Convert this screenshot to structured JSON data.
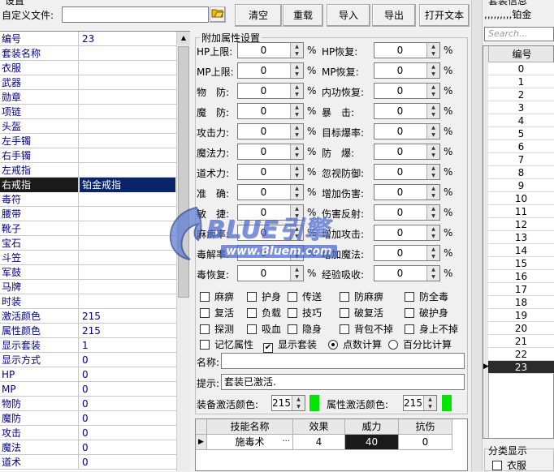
{
  "header": {
    "title_top": "设置",
    "custom_file_label": "自定义文件:",
    "custom_file_value": "",
    "buttons": [
      "清空",
      "重载",
      "导入",
      "导出",
      "打开文本"
    ]
  },
  "left_list": {
    "rows": [
      {
        "k": "编号",
        "v": "23"
      },
      {
        "k": "套装名称",
        "v": ""
      },
      {
        "k": "衣服",
        "v": ""
      },
      {
        "k": "武器",
        "v": ""
      },
      {
        "k": "勋章",
        "v": ""
      },
      {
        "k": "项链",
        "v": ""
      },
      {
        "k": "头盔",
        "v": ""
      },
      {
        "k": "左手镯",
        "v": ""
      },
      {
        "k": "右手镯",
        "v": ""
      },
      {
        "k": "左戒指",
        "v": ""
      },
      {
        "k": "右戒指",
        "v": "铂金戒指"
      },
      {
        "k": "毒符",
        "v": ""
      },
      {
        "k": "腰带",
        "v": ""
      },
      {
        "k": "靴子",
        "v": ""
      },
      {
        "k": "宝石",
        "v": ""
      },
      {
        "k": "斗笠",
        "v": ""
      },
      {
        "k": "军鼓",
        "v": ""
      },
      {
        "k": "马牌",
        "v": ""
      },
      {
        "k": "时装",
        "v": ""
      },
      {
        "k": "激活颜色",
        "v": "215"
      },
      {
        "k": "属性颜色",
        "v": "215"
      },
      {
        "k": "显示套装",
        "v": "1"
      },
      {
        "k": "显示方式",
        "v": "0"
      },
      {
        "k": "HP",
        "v": "0"
      },
      {
        "k": "MP",
        "v": "0"
      },
      {
        "k": "物防",
        "v": "0"
      },
      {
        "k": "魔防",
        "v": "0"
      },
      {
        "k": "攻击",
        "v": "0"
      },
      {
        "k": "魔法",
        "v": "0"
      },
      {
        "k": "道术",
        "v": "0"
      }
    ]
  },
  "attr": {
    "group_title": "附加属性设置",
    "pct": "%",
    "left_fields": [
      {
        "label": "HP上限:",
        "value": "0"
      },
      {
        "label": "MP上限:",
        "value": "0"
      },
      {
        "label": "物　防:",
        "value": "0"
      },
      {
        "label": "魔　防:",
        "value": "0"
      },
      {
        "label": "攻击力:",
        "value": "0"
      },
      {
        "label": "魔法力:",
        "value": "0"
      },
      {
        "label": "道术力:",
        "value": "0"
      },
      {
        "label": "准　确:",
        "value": "0"
      },
      {
        "label": "敏　捷:",
        "value": "0"
      },
      {
        "label": "麻痹率:",
        "value": "0"
      },
      {
        "label": "毒解率:",
        "value": "0"
      },
      {
        "label": "毒恢复:",
        "value": "0"
      }
    ],
    "right_fields": [
      {
        "label": "HP恢复:",
        "value": "0"
      },
      {
        "label": "MP恢复:",
        "value": "0"
      },
      {
        "label": "内功恢复:",
        "value": "0"
      },
      {
        "label": "暴　击:",
        "value": "0"
      },
      {
        "label": "目标爆率:",
        "value": "0"
      },
      {
        "label": "防　爆:",
        "value": "0"
      },
      {
        "label": "忽视防御:",
        "value": "0"
      },
      {
        "label": "增加伤害:",
        "value": "0"
      },
      {
        "label": "伤害反射:",
        "value": "0"
      },
      {
        "label": "增加攻击:",
        "value": "0"
      },
      {
        "label": "增加魔法:",
        "value": "0"
      },
      {
        "label": "经验吸收:",
        "value": "0"
      }
    ],
    "checks_row1": [
      "麻痹",
      "护身",
      "传送",
      "防麻痹",
      "防全毒"
    ],
    "checks_row2": [
      "复活",
      "负载",
      "技巧",
      "破复活",
      "破护身"
    ],
    "checks_row3": [
      "探测",
      "吸血",
      "隐身",
      "背包不掉",
      "身上不掉"
    ],
    "memory_label": "记忆属性",
    "show_suit_label": "显示套装",
    "point_calc": "点数计算",
    "percent_calc": "百分比计算",
    "name_label": "名称:",
    "name_value": "",
    "tip_label": "提示:",
    "tip_value": "套装已激活.",
    "equip_color_label": "装备激活颜色:",
    "equip_color_value": "215",
    "attr_color_label": "属性激活颜色:",
    "attr_color_value": "215",
    "green_color": "#00e600"
  },
  "skill_grid": {
    "headers": [
      "技能名称",
      "效果",
      "威力",
      "抗伤"
    ],
    "rows": [
      {
        "name": "施毒术",
        "more": "···",
        "effect": "4",
        "power": "40",
        "resist": "0"
      }
    ]
  },
  "right_panel": {
    "title": "套装信息",
    "subtitle": ",,,,,,,,,铂金",
    "search_placeholder": "Search...",
    "col_header": "编号",
    "ids": [
      "0",
      "1",
      "2",
      "3",
      "4",
      "5",
      "6",
      "7",
      "8",
      "9",
      "10",
      "11",
      "12",
      "13",
      "14",
      "15",
      "16",
      "17",
      "18",
      "19",
      "20",
      "21",
      "22",
      "23"
    ],
    "category_title": "分类显示",
    "category_item": "衣服"
  },
  "watermark": {
    "brand": "BLUE引擎",
    "url": "www.Bluem.com"
  }
}
